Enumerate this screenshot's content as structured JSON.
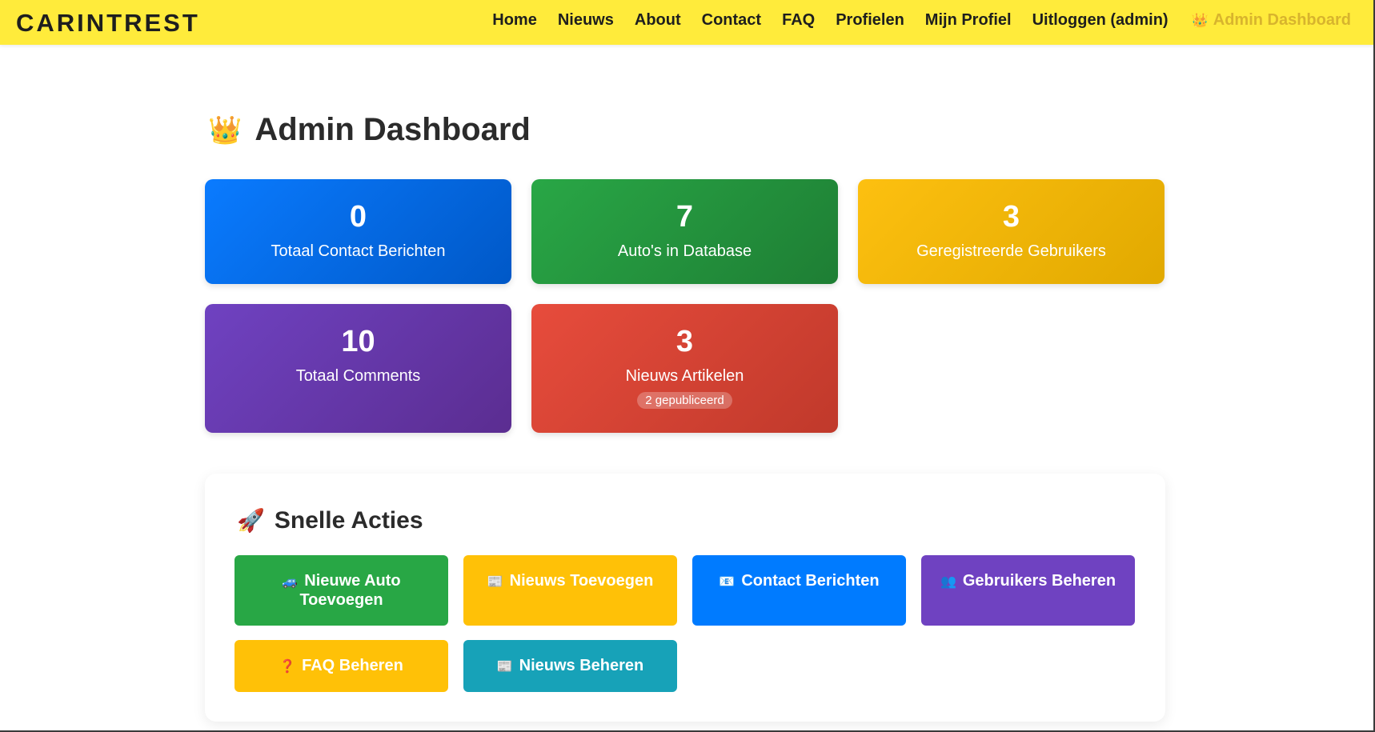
{
  "navbar": {
    "brand": "CARINTREST",
    "links": [
      "Home",
      "Nieuws",
      "About",
      "Contact",
      "FAQ",
      "Profielen",
      "Mijn Profiel",
      "Uitloggen (admin)"
    ],
    "active_icon": "👑",
    "active_label": "Admin Dashboard"
  },
  "page": {
    "icon": "👑",
    "title": "Admin Dashboard"
  },
  "stats": [
    {
      "value": "0",
      "label": "Totaal Contact Berichten",
      "color": "#0a7bff"
    },
    {
      "value": "7",
      "label": "Auto's in Database",
      "color": "#29a746"
    },
    {
      "value": "3",
      "label": "Geregistreerde Gebruikers",
      "color": "#fdc010"
    },
    {
      "value": "10",
      "label": "Totaal Comments",
      "color": "#6f42c1"
    },
    {
      "value": "3",
      "label": "Nieuws Artikelen",
      "badge": "2 gepubliceerd",
      "color": "#e74c3c"
    }
  ],
  "quick_actions": {
    "icon": "🚀",
    "title": "Snelle Acties",
    "buttons": [
      {
        "icon": "🚙",
        "label": "Nieuwe Auto Toevoegen",
        "color": "#28a745"
      },
      {
        "icon": "📰",
        "label": "Nieuws Toevoegen",
        "color": "#ffc107"
      },
      {
        "icon": "📧",
        "label": "Contact Berichten",
        "color": "#007bff"
      },
      {
        "icon": "👥",
        "label": "Gebruikers Beheren",
        "color": "#6f42c1"
      },
      {
        "icon": "❓",
        "label": "FAQ Beheren",
        "color": "#ffc107"
      },
      {
        "icon": "📰",
        "label": "Nieuws Beheren",
        "color": "#17a2b8"
      }
    ]
  }
}
